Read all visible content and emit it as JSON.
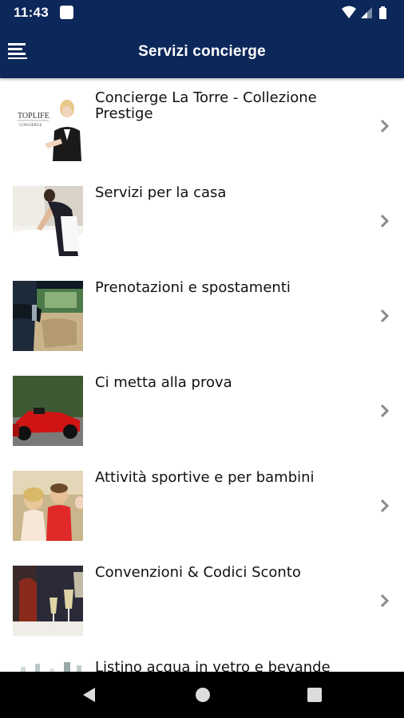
{
  "status_bar": {
    "time": "11:43"
  },
  "app_bar": {
    "title": "Servizi concierge"
  },
  "thumb_text": {
    "brand": "TOPLIFE",
    "sub": "CONCIERGE"
  },
  "items": [
    {
      "label": "Concierge La Torre - Collezione Prestige"
    },
    {
      "label": "Servizi per la casa"
    },
    {
      "label": "Prenotazioni e spostamenti"
    },
    {
      "label": "Ci metta alla prova"
    },
    {
      "label": "Attività sportive e per bambini"
    },
    {
      "label": "Convenzioni & Codici Sconto"
    },
    {
      "label": "Listino acqua in vetro e bevande"
    }
  ],
  "colors": {
    "primary": "#0c2759",
    "chevron": "#8a8a8a"
  }
}
